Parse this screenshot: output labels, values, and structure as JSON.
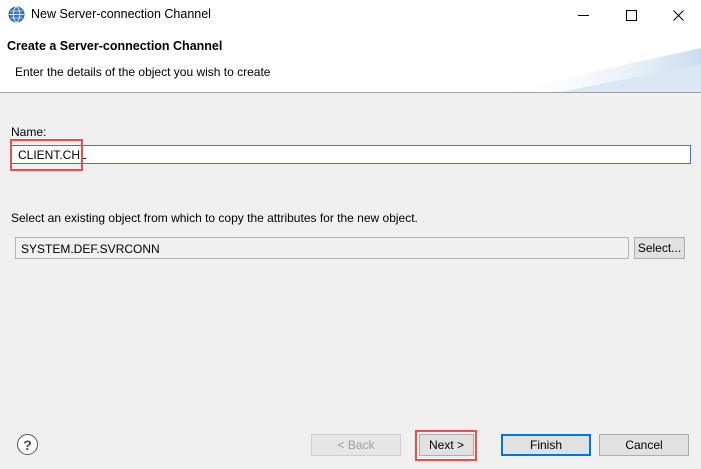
{
  "window": {
    "title": "New Server-connection Channel",
    "icon": "globe-icon"
  },
  "banner": {
    "title": "Create a Server-connection Channel",
    "description": "Enter the details of the object you wish to create"
  },
  "form": {
    "name_label": "Name:",
    "name_value": "CLIENT.CHL",
    "copy_label": "Select an existing object from which to copy the attributes for the new object.",
    "copy_value": "SYSTEM.DEF.SVRCONN",
    "select_button": "Select..."
  },
  "footer": {
    "help_label": "?",
    "back_button": "< Back",
    "next_button": "Next >",
    "finish_button": "Finish",
    "cancel_button": "Cancel"
  },
  "colors": {
    "highlight": "#e8504a",
    "focus": "#2b7bd1",
    "default_button": "#0078d7"
  }
}
